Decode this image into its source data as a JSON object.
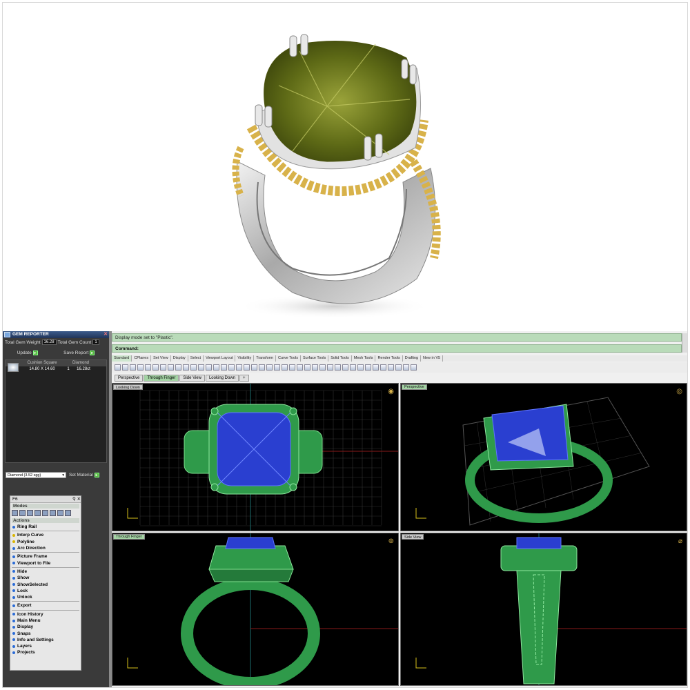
{
  "gem_reporter": {
    "title": "GEM REPORTER",
    "total_weight_label": "Total Gem Weight",
    "total_weight_value": "16.28",
    "total_count_label": "Total Gem Count",
    "total_count_value": "1",
    "update_label": "Update",
    "save_report_label": "Save Report",
    "table_headers": [
      "Cushion Square",
      "Diamond"
    ],
    "table_row": [
      "14.80 X 14.60",
      "1",
      "16.28ct"
    ],
    "material_select": "Diamond  (3.52 sgg)",
    "set_material_label": "Set Material"
  },
  "f6_panel": {
    "title": "F6",
    "modes_label": "Modes",
    "actions_label": "Actions",
    "items": [
      {
        "label": "Ring Rail",
        "bold": true,
        "dot": "blue"
      },
      {
        "sep": true
      },
      {
        "label": "Interp Curve",
        "bold": true,
        "dot": "yellow"
      },
      {
        "label": "Polyline",
        "bold": true,
        "dot": "yellow"
      },
      {
        "label": "Arc Direction",
        "bold": true,
        "dot": "blue"
      },
      {
        "sep": true
      },
      {
        "label": "Picture Frame",
        "bold": true,
        "dot": "blue"
      },
      {
        "label": "Viewport to File",
        "bold": true,
        "dot": "blue"
      },
      {
        "sep": true
      },
      {
        "label": "Hide",
        "bold": true,
        "dot": "blue"
      },
      {
        "label": "Show",
        "bold": true,
        "dot": "blue"
      },
      {
        "label": "ShowSelected",
        "bold": true,
        "dot": "blue"
      },
      {
        "label": "Lock",
        "bold": true,
        "dot": "blue"
      },
      {
        "label": "Unlock",
        "bold": true,
        "dot": "blue"
      },
      {
        "sep": true
      },
      {
        "label": "Export",
        "bold": true,
        "dot": "blue"
      },
      {
        "sep": true
      },
      {
        "label": "Icon History",
        "bold": true,
        "dot": "blue"
      },
      {
        "label": "Main Menu",
        "bold": true,
        "dot": "blue"
      },
      {
        "label": "Display",
        "bold": true,
        "dot": "blue"
      },
      {
        "label": "Snaps",
        "bold": true,
        "dot": "blue"
      },
      {
        "label": "Info and Settings",
        "bold": true,
        "dot": "blue"
      },
      {
        "label": "Layers",
        "bold": true,
        "dot": "blue"
      },
      {
        "label": "Projects",
        "bold": true,
        "dot": "blue"
      }
    ]
  },
  "command": {
    "history": "Display mode set to \"Plastic\".",
    "prompt": "Command:"
  },
  "toolbar_tabs": [
    "Standard",
    "CPlanes",
    "Set View",
    "Display",
    "Select",
    "Viewport Layout",
    "Visibility",
    "Transform",
    "Curve Tools",
    "Surface Tools",
    "Solid Tools",
    "Mesh Tools",
    "Render Tools",
    "Drafting",
    "New in V5"
  ],
  "viewport_tabs": [
    "Perspective",
    "Through Finger",
    "Side View",
    "Looking Down"
  ],
  "viewports": {
    "top_left": "Looking Down",
    "top_right": "Perspective",
    "bottom_left": "Through Finger",
    "bottom_right": "Side View"
  },
  "colors": {
    "model_green": "#2f9a4a",
    "gem_blue": "#2a3fd0",
    "gem_olive": "#6f7a1e",
    "metal_silver": "#c9c9c9",
    "metal_gold": "#d8b24a"
  }
}
